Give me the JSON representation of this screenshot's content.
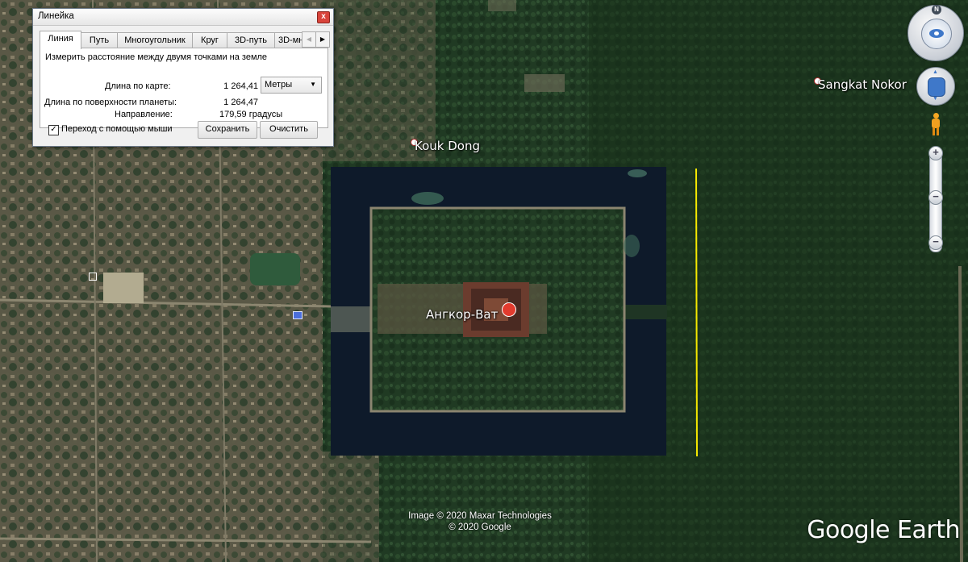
{
  "dialog": {
    "title": "Линейка",
    "close_glyph": "x",
    "tabs": [
      "Линия",
      "Путь",
      "Многоугольник",
      "Круг",
      "3D-путь",
      "3D-мн"
    ],
    "active_tab": "Линия",
    "description": "Измерить расстояние между двумя точками на земле",
    "map_length_label": "Длина по карте:",
    "map_length_value": "1 264,41",
    "units_selected": "Метры",
    "surface_length_label": "Длина по поверхности планеты:",
    "surface_length_value": "1 264,47",
    "heading_label": "Направление:",
    "heading_value": "179,59 градусы",
    "mouse_nav_label": "Переход с помощью мыши",
    "mouse_nav_checked": true,
    "save_label": "Сохранить",
    "clear_label": "Очистить"
  },
  "map": {
    "places": [
      {
        "name": "Kouk Dong"
      },
      {
        "name": "Sangkat Nokor"
      },
      {
        "name": "Ангкор-Ват"
      }
    ],
    "measure_line_color": "#f5e800",
    "credits": [
      "Image © 2020 Maxar Technologies",
      "© 2020 Google"
    ],
    "logo": "Google Earth"
  },
  "nav": {
    "compass_letter": "N",
    "zoom_in": "+",
    "zoom_out": "−"
  }
}
